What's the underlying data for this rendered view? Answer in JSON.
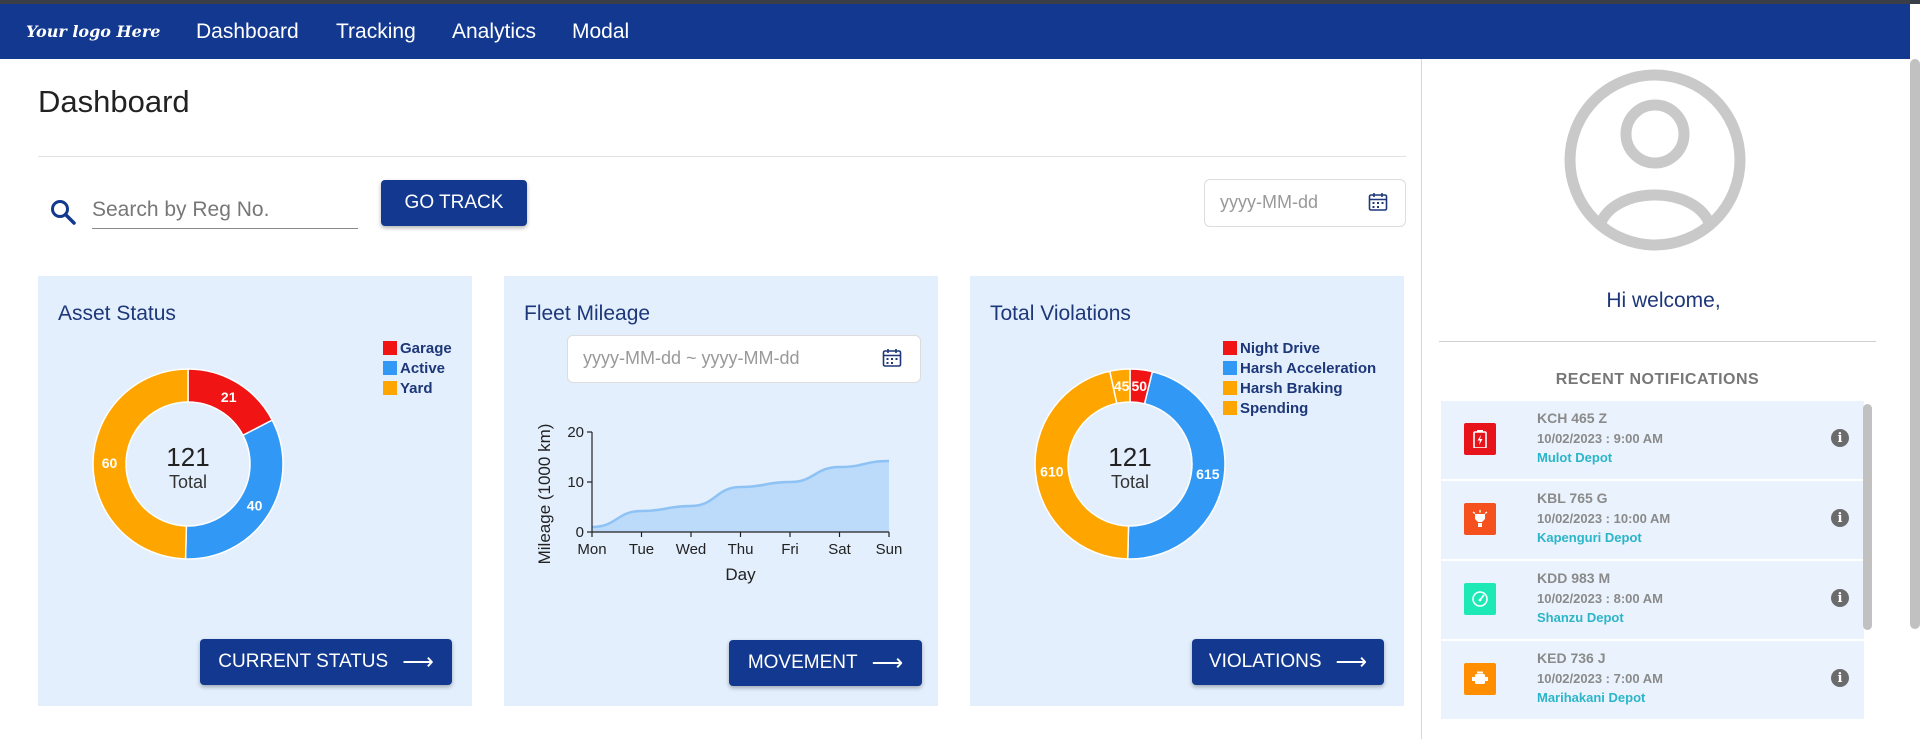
{
  "nav": {
    "logo": "Your logo Here",
    "links": [
      "Dashboard",
      "Tracking",
      "Analytics",
      "Modal"
    ]
  },
  "page": {
    "title": "Dashboard",
    "search_placeholder": "Search by Reg No.",
    "go_track_label": "GO TRACK",
    "date_placeholder": "yyyy-MM-dd"
  },
  "cards": {
    "asset_status": {
      "title": "Asset Status",
      "legend": [
        "Garage",
        "Active",
        "Yard"
      ],
      "total": "121",
      "total_label": "Total",
      "button_label": "CURRENT STATUS"
    },
    "fleet_mileage": {
      "title": "Fleet Mileage",
      "date_range_placeholder": "yyyy-MM-dd ~ yyyy-MM-dd",
      "button_label": "MOVEMENT"
    },
    "violations": {
      "title": "Total Violations",
      "legend": [
        "Night Drive",
        "Harsh Acceleration",
        "Harsh Braking",
        "Spending"
      ],
      "total": "121",
      "total_label": "Total",
      "button_label": "VIOLATIONS"
    }
  },
  "colors": {
    "primary": "#12398f",
    "red": "#f01414",
    "blue": "#3198f5",
    "orange": "#ffa500",
    "card_bg": "#e3effd"
  },
  "chart_data": [
    {
      "type": "pie",
      "title": "Asset Status",
      "categories": [
        "Garage",
        "Active",
        "Yard"
      ],
      "values": [
        21,
        40,
        60
      ],
      "colors": [
        "#f01414",
        "#3198f5",
        "#ffa500"
      ]
    },
    {
      "type": "area",
      "title": "Fleet Mileage",
      "xlabel": "Day",
      "ylabel": "Mileage (1000 km)",
      "categories": [
        "Mon",
        "Tue",
        "Wed",
        "Thu",
        "Fri",
        "Sat",
        "Sun"
      ],
      "values": [
        1,
        4.2,
        5.2,
        9,
        10,
        13,
        14.2
      ],
      "ylim": [
        0,
        20
      ],
      "yticks": [
        0,
        10,
        20
      ],
      "grid": false
    },
    {
      "type": "pie",
      "title": "Total Violations",
      "categories": [
        "Night Drive",
        "Harsh Acceleration",
        "Harsh Braking",
        "Spending"
      ],
      "values": [
        50,
        615,
        610,
        45
      ],
      "slice_labels": [
        "50",
        "615",
        "610",
        "45"
      ],
      "colors": [
        "#f01414",
        "#3198f5",
        "#ffa500",
        "#ffa500"
      ]
    }
  ],
  "sidebar": {
    "welcome": "Hi welcome,",
    "notifications_title": "RECENT NOTIFICATIONS",
    "notifications": [
      {
        "reg": "KCH 465 Z",
        "time": "10/02/2023 : 9:00 AM",
        "depot": "Mulot Depot",
        "icon": "battery-icon",
        "color": "#e8141c"
      },
      {
        "reg": "KBL 765 G",
        "time": "10/02/2023 : 10:00 AM",
        "depot": "Kapenguri Depot",
        "icon": "light-icon",
        "color": "#f4511e"
      },
      {
        "reg": "KDD 983 M",
        "time": "10/02/2023 : 8:00 AM",
        "depot": "Shanzu Depot",
        "icon": "speedometer-icon",
        "color": "#1de9b6"
      },
      {
        "reg": "KED 736 J",
        "time": "10/02/2023 : 7:00 AM",
        "depot": "Marihakani Depot",
        "icon": "engine-icon",
        "color": "#ff8f00"
      }
    ]
  }
}
